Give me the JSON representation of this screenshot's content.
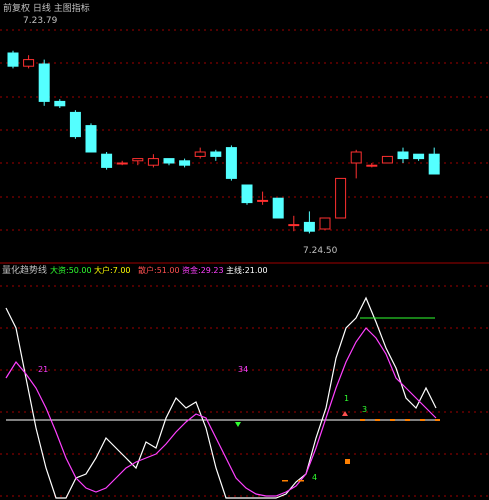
{
  "window": {
    "title": "前复权 日线 主图指标",
    "title_color": "#c0c0c0"
  },
  "colors": {
    "up": "#ff3030",
    "down": "#54ffff",
    "grid": "#a00000",
    "white_line": "#ffffff",
    "magenta_line": "#ff40ff",
    "signal_green": "#30ff30",
    "signal_red": "#ff5050",
    "signal_orange": "#ff8000",
    "label_yellow": "#ffff00"
  },
  "price_labels": {
    "high": "7.23.79",
    "low": "7.24.50"
  },
  "indicator_header": {
    "name": "量化趋势线",
    "items": [
      {
        "label": "大资:",
        "value": "50.00",
        "color": "#30ff30"
      },
      {
        "label": "大户:",
        "value": "7.00",
        "color": "#ffff00"
      },
      {
        "label": "散户:",
        "value": "51.00",
        "color": "#ff5050"
      },
      {
        "label": "资金:",
        "value": "29.23",
        "color": "#ff40ff"
      },
      {
        "label": "主线:",
        "value": "21.00",
        "color": "#ffffff"
      }
    ]
  },
  "chart_data": [
    {
      "type": "candlestick",
      "ylim": [
        0,
        100
      ],
      "candles": [
        {
          "o": 85,
          "c": 79,
          "h": 86,
          "l": 78
        },
        {
          "o": 79,
          "c": 82,
          "h": 84,
          "l": 78
        },
        {
          "o": 80,
          "c": 63,
          "h": 82,
          "l": 61
        },
        {
          "o": 63,
          "c": 61,
          "h": 64,
          "l": 60
        },
        {
          "o": 58,
          "c": 47,
          "h": 59,
          "l": 46
        },
        {
          "o": 52,
          "c": 40,
          "h": 53,
          "l": 40
        },
        {
          "o": 39,
          "c": 33,
          "h": 40,
          "l": 32
        },
        {
          "o": 35,
          "c": 35,
          "h": 36,
          "l": 34
        },
        {
          "o": 36,
          "c": 37,
          "h": 37,
          "l": 34
        },
        {
          "o": 34,
          "c": 37,
          "h": 39,
          "l": 33
        },
        {
          "o": 37,
          "c": 35,
          "h": 37,
          "l": 34
        },
        {
          "o": 36,
          "c": 34,
          "h": 37,
          "l": 33
        },
        {
          "o": 38,
          "c": 40,
          "h": 42,
          "l": 37
        },
        {
          "o": 40,
          "c": 38,
          "h": 41,
          "l": 36
        },
        {
          "o": 42,
          "c": 28,
          "h": 43,
          "l": 27
        },
        {
          "o": 25,
          "c": 17,
          "h": 25,
          "l": 16
        },
        {
          "o": 18,
          "c": 18,
          "h": 22,
          "l": 16
        },
        {
          "o": 19,
          "c": 10,
          "h": 19,
          "l": 10
        },
        {
          "o": 7,
          "c": 7,
          "h": 11,
          "l": 4
        },
        {
          "o": 8,
          "c": 4,
          "h": 13,
          "l": 3
        },
        {
          "o": 5,
          "c": 10,
          "h": 10,
          "l": 5
        },
        {
          "o": 10,
          "c": 28,
          "h": 28,
          "l": 10
        },
        {
          "o": 35,
          "c": 40,
          "h": 41,
          "l": 28
        },
        {
          "o": 34,
          "c": 34,
          "h": 35,
          "l": 33
        },
        {
          "o": 35,
          "c": 38,
          "h": 38,
          "l": 35
        },
        {
          "o": 40,
          "c": 37,
          "h": 42,
          "l": 35
        },
        {
          "o": 39,
          "c": 37,
          "h": 39,
          "l": 36
        },
        {
          "o": 39,
          "c": 30,
          "h": 42,
          "l": 30
        }
      ]
    },
    {
      "type": "line",
      "ylim": [
        0,
        100
      ],
      "series": [
        {
          "color": "#ffffff",
          "values": [
            95,
            85,
            60,
            35,
            15,
            0,
            0,
            10,
            12,
            20,
            30,
            25,
            20,
            15,
            28,
            25,
            40,
            50,
            45,
            48,
            35,
            15,
            0,
            0,
            0,
            0,
            0,
            0,
            2,
            8,
            12,
            30,
            45,
            70,
            85,
            90,
            100,
            88,
            75,
            65,
            50,
            45,
            55,
            45
          ]
        },
        {
          "color": "#ff40ff",
          "values": [
            60,
            68,
            62,
            55,
            45,
            33,
            20,
            10,
            5,
            3,
            5,
            10,
            15,
            18,
            20,
            22,
            27,
            33,
            38,
            42,
            40,
            30,
            20,
            10,
            5,
            2,
            1,
            1,
            3,
            6,
            12,
            25,
            40,
            55,
            68,
            78,
            85,
            80,
            72,
            60,
            55,
            50,
            45,
            40
          ]
        },
        {
          "color": "#30ff30",
          "values": [
            90,
            90,
            90,
            90,
            90,
            90,
            90,
            90,
            90,
            90,
            90
          ]
        }
      ],
      "annotations": [
        "21",
        "34",
        "1",
        "3",
        "4"
      ]
    }
  ]
}
